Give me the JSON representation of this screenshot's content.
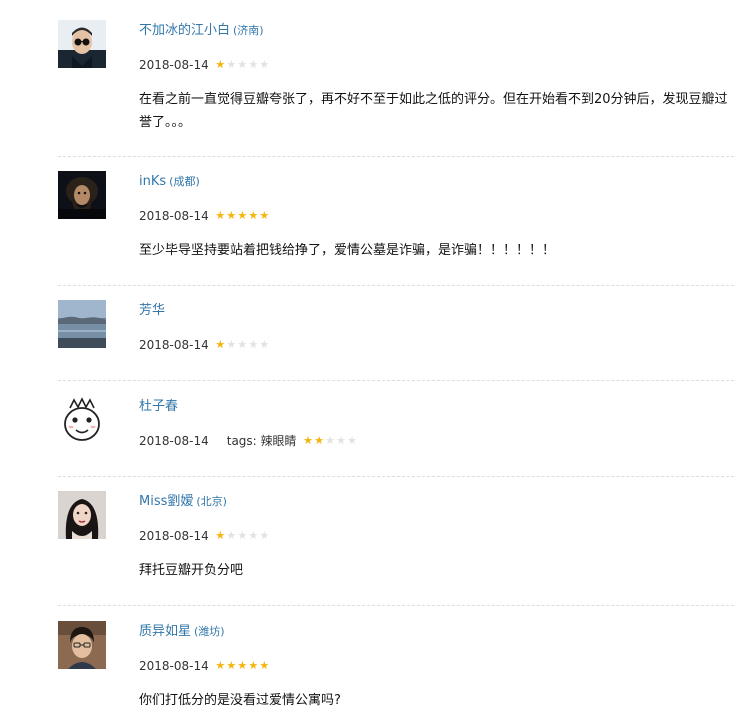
{
  "comments": [
    {
      "avatar_icon": "avatar-sunglasses-man-icon",
      "user": "不加冰的江小白",
      "location": "(济南)",
      "date": "2018-08-14",
      "tags": "",
      "rating": 1,
      "text": "在看之前一直觉得豆瓣夸张了，再不好不至于如此之低的评分。但在开始看不到20分钟后，发现豆瓣过誉了。。。"
    },
    {
      "avatar_icon": "avatar-bearded-man-icon",
      "user": "inKs",
      "location": "(成都)",
      "date": "2018-08-14",
      "tags": "",
      "rating": 5,
      "text": "至少毕导坚持要站着把钱给挣了，爱情公墓是诈骗，是诈骗！！！！！！"
    },
    {
      "avatar_icon": "avatar-lake-landscape-icon",
      "user": "芳华",
      "location": "",
      "date": "2018-08-14",
      "tags": "",
      "rating": 1,
      "text": ""
    },
    {
      "avatar_icon": "avatar-cartoon-face-icon",
      "user": "杜子春",
      "location": "",
      "date": "2018-08-14",
      "tags": "tags: 辣眼睛",
      "rating": 2,
      "text": ""
    },
    {
      "avatar_icon": "avatar-woman-portrait-icon",
      "user": "Miss劉嫒",
      "location": "(北京)",
      "date": "2018-08-14",
      "tags": "",
      "rating": 1,
      "text": "拜托豆瓣开负分吧"
    },
    {
      "avatar_icon": "avatar-young-man-icon",
      "user": "质异如星",
      "location": "(潍坊)",
      "date": "2018-08-14",
      "tags": "",
      "rating": 5,
      "text": "你们打低分的是没看过爱情公寓吗?"
    }
  ],
  "colors": {
    "link": "#3377aa",
    "star_on": "#f5b50a",
    "star_off": "#e2e2e2",
    "divider": "#dddddd"
  }
}
